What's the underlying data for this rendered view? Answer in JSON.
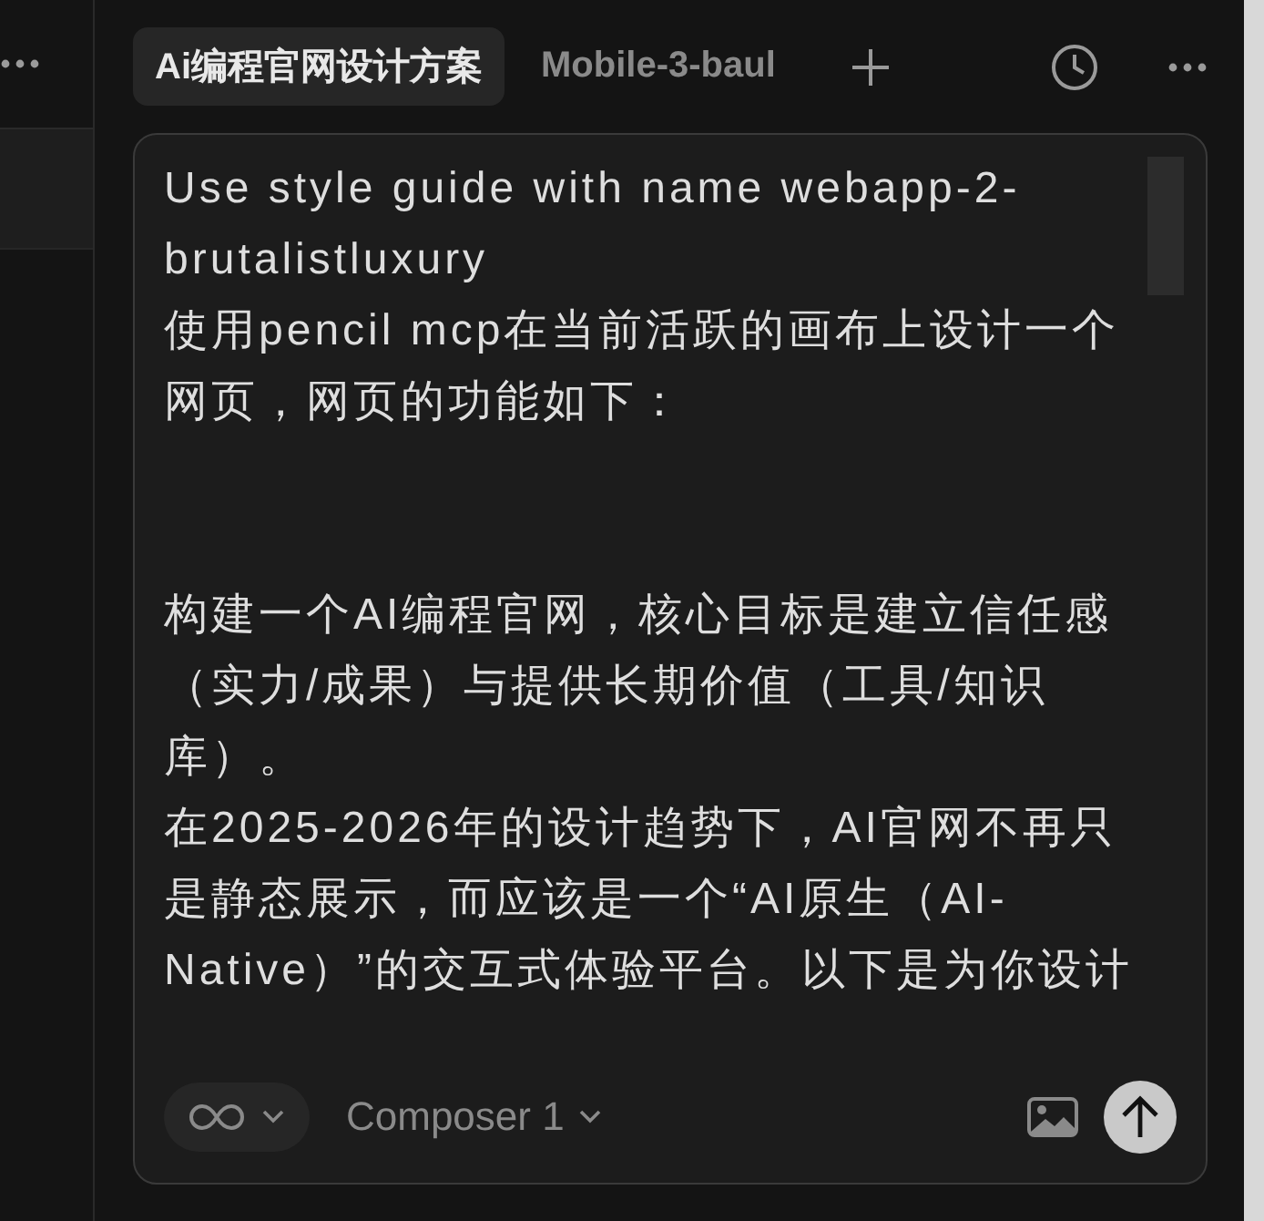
{
  "tabs": [
    {
      "label": "Ai编程官网设计方案",
      "selected": true
    },
    {
      "label": "Mobile-3-baul",
      "selected": false
    }
  ],
  "composer": {
    "paragraphs": [
      "Use style guide with name webapp-2-brutalistluxury",
      "使用pencil mcp在当前活跃的画布上设计一个网页，网页的功能如下：",
      "构建一个AI编程官网，核心目标是建立信任感（实力/成果）与提供长期价值（工具/知识库）。",
      "在2025-2026年的设计趋势下，AI官网不再只是静态展示，而应该是一个“AI原生（AI-Native）”的交互式体验平台。以下是为你设计"
    ],
    "model": "Composer 1"
  }
}
